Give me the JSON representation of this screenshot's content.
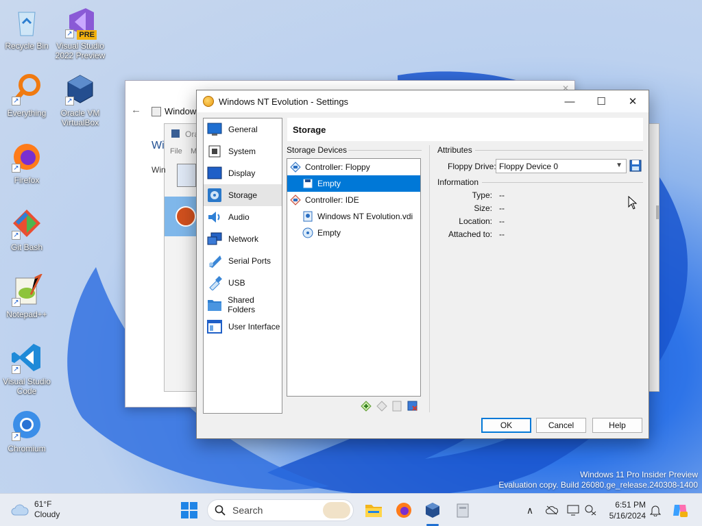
{
  "desktop": {
    "icons": [
      {
        "label": "Recycle Bin"
      },
      {
        "label": "Visual Studio 2022 Preview",
        "badge": "PRE"
      },
      {
        "label": "Everything"
      },
      {
        "label": "Oracle VM VirtualBox"
      },
      {
        "label": "Firefox"
      },
      {
        "label": "Git Bash"
      },
      {
        "label": "Notepad++"
      },
      {
        "label": "Visual Studio Code"
      },
      {
        "label": "Chromium"
      }
    ],
    "watermark": {
      "line1": "Windows 11 Pro Insider Preview",
      "line2": "Evaluation copy. Build 26080.ge_release.240308-1400"
    }
  },
  "background_windows": {
    "window1_title": "Windows",
    "window2_title": "Ora",
    "window2_menu_file": "File",
    "window2_menu_m": "M",
    "window2_heading": "Wi",
    "window2_text": "Win"
  },
  "dialog": {
    "title": "Windows NT Evolution - Settings",
    "controls": {
      "minimize": "—",
      "maximize": "☐",
      "close": "✕"
    },
    "nav": [
      {
        "label": "General",
        "icon": "general-icon"
      },
      {
        "label": "System",
        "icon": "system-icon"
      },
      {
        "label": "Display",
        "icon": "display-icon"
      },
      {
        "label": "Storage",
        "icon": "storage-icon",
        "selected": true
      },
      {
        "label": "Audio",
        "icon": "audio-icon"
      },
      {
        "label": "Network",
        "icon": "network-icon"
      },
      {
        "label": "Serial Ports",
        "icon": "serial-ports-icon"
      },
      {
        "label": "USB",
        "icon": "usb-icon"
      },
      {
        "label": "Shared Folders",
        "icon": "shared-folders-icon"
      },
      {
        "label": "User Interface",
        "icon": "user-interface-icon"
      }
    ],
    "page_title": "Storage",
    "storage_devices_label": "Storage Devices",
    "tree": [
      {
        "label": "Controller: Floppy",
        "level": 0,
        "icon": "floppy-controller-icon"
      },
      {
        "label": "Empty",
        "level": 1,
        "icon": "floppy-disk-icon",
        "selected": true
      },
      {
        "label": "Controller: IDE",
        "level": 0,
        "icon": "ide-controller-icon"
      },
      {
        "label": "Windows NT Evolution.vdi",
        "level": 1,
        "icon": "hard-disk-icon"
      },
      {
        "label": "Empty",
        "level": 1,
        "icon": "optical-disk-icon"
      }
    ],
    "attributes": {
      "heading": "Attributes",
      "floppy_drive_label": "Floppy Drive:",
      "floppy_drive_value": "Floppy Device 0"
    },
    "information": {
      "heading": "Information",
      "rows": [
        {
          "key": "Type:",
          "value": "--"
        },
        {
          "key": "Size:",
          "value": "--"
        },
        {
          "key": "Location:",
          "value": "--"
        },
        {
          "key": "Attached to:",
          "value": "--"
        }
      ]
    },
    "buttons": {
      "ok": "OK",
      "cancel": "Cancel",
      "help": "Help"
    }
  },
  "taskbar": {
    "weather_temp": "61°F",
    "weather_desc": "Cloudy",
    "search_placeholder": "Search",
    "time": "6:51 PM",
    "date": "5/16/2024"
  }
}
